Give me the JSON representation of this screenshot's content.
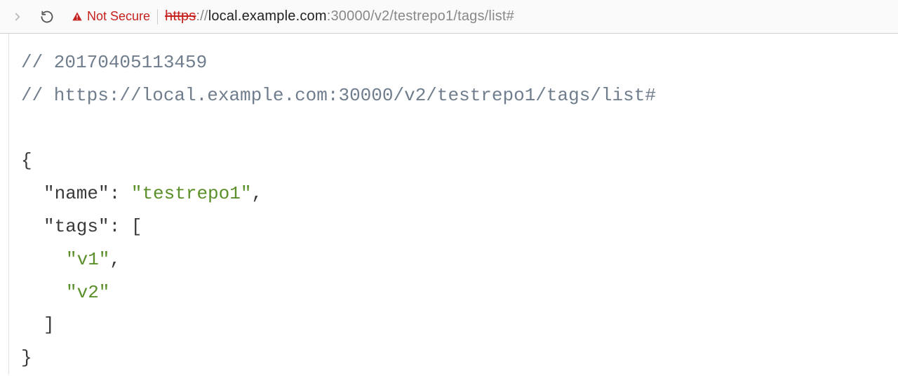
{
  "toolbar": {
    "security_label": "Not Secure",
    "url_scheme": "https",
    "url_sep": "://",
    "url_host": "local.example.com",
    "url_port": ":30000",
    "url_path": "/v2/testrepo1/tags/list#"
  },
  "body": {
    "comment1": "// 20170405113459",
    "comment2": "// https://local.example.com:30000/v2/testrepo1/tags/list#",
    "brace_open": "{",
    "key_name": "\"name\"",
    "colon": ":",
    "val_name": "\"testrepo1\"",
    "comma": ",",
    "key_tags": "\"tags\"",
    "bracket_open": "[",
    "val_v1": "\"v1\"",
    "val_v2": "\"v2\"",
    "bracket_close": "]",
    "brace_close": "}"
  }
}
